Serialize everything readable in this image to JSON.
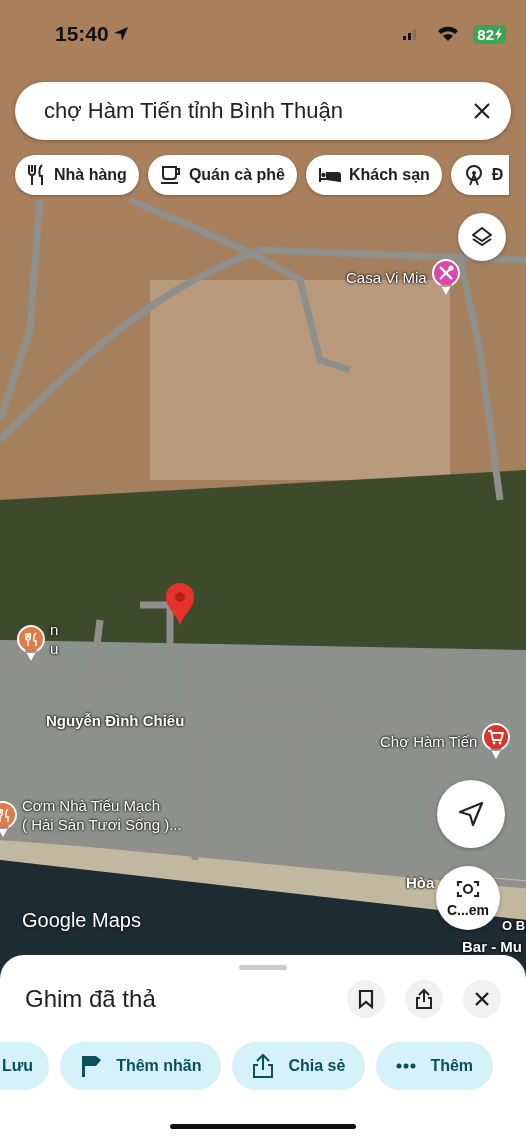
{
  "status_bar": {
    "time": "15:40",
    "battery": "82"
  },
  "search": {
    "value": "chợ Hàm Tiến tỉnh Bình Thuận"
  },
  "category_chips": [
    {
      "label": "Nhà hàng",
      "kind": "restaurant"
    },
    {
      "label": "Quán cà phê",
      "kind": "cafe"
    },
    {
      "label": "Khách sạn",
      "kind": "hotel"
    },
    {
      "label": "Đ",
      "kind": "attraction"
    }
  ],
  "map": {
    "places": [
      {
        "lines": [
          "Casa Vi Mia"
        ],
        "kind": "shop",
        "color": "#d946b0"
      },
      {
        "lines": [
          "n",
          "u"
        ],
        "kind": "restaurant",
        "color": "#e07b4a"
      },
      {
        "lines": [
          "Chợ Hàm Tiến"
        ],
        "kind": "market",
        "color": "#d9342b"
      },
      {
        "lines": [
          "Cơm Nhà Tiểu Mạch",
          "( Hải Sản Tươi Sống )..."
        ],
        "kind": "restaurant",
        "color": "#e07b4a"
      }
    ],
    "street_labels": [
      "Nguyễn Đình Chiểu",
      "Hòa",
      "O B",
      "Bar - Mu"
    ],
    "camera_button": {
      "label": "C...em"
    },
    "logo": "Google Maps"
  },
  "sheet": {
    "title": "Ghim đã thả",
    "actions": [
      {
        "label": "Lưu",
        "kind": "save"
      },
      {
        "label": "Thêm nhãn",
        "kind": "label"
      },
      {
        "label": "Chia sẻ",
        "kind": "share"
      },
      {
        "label": "Thêm",
        "kind": "more"
      }
    ]
  }
}
